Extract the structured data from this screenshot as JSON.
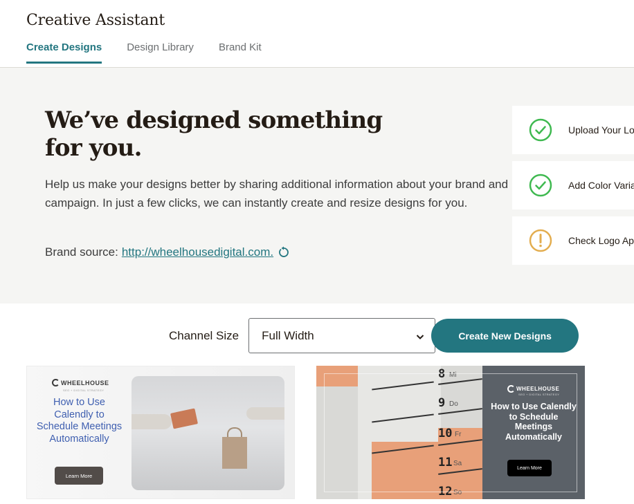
{
  "app": {
    "title": "Creative Assistant"
  },
  "tabs": [
    {
      "label": "Create Designs",
      "active": true
    },
    {
      "label": "Design Library",
      "active": false
    },
    {
      "label": "Brand Kit",
      "active": false
    }
  ],
  "hero": {
    "title": "We’ve designed something for you.",
    "description": "Help us make your designs better by sharing additional information about your brand and campaign. In just a few clicks, we can instantly create and resize designs for you.",
    "brand_source_label": "Brand source:",
    "brand_source_url": "http://wheelhousedigital.com.",
    "refresh_icon": "refresh-icon"
  },
  "checklist": [
    {
      "label": "Upload Your Logo",
      "status": "complete",
      "icon": "check-circle-icon",
      "color": "#3fb950"
    },
    {
      "label": "Add Color Variations",
      "status": "complete",
      "icon": "check-circle-icon",
      "color": "#3fb950"
    },
    {
      "label": "Check Logo Appearance",
      "status": "warning",
      "icon": "exclamation-circle-icon",
      "color": "#e3ad4f"
    }
  ],
  "controls": {
    "channel_size_label": "Channel Size",
    "channel_size_value": "Full Width",
    "create_button_label": "Create New Designs"
  },
  "designs": [
    {
      "brand": "WHEELHOUSE",
      "brand_tagline": "SEO + DIGITAL STRATEGY",
      "headline": "How to Use Calendly to Schedule Meetings Automatically",
      "cta": "Learn More"
    },
    {
      "brand": "WHEELHOUSE",
      "brand_tagline": "SEO + DIGITAL STRATEGY",
      "headline": "How to Use Calendly to Schedule Meetings Automatically",
      "cta": "Learn More",
      "calendar_days": [
        {
          "num": "8",
          "day": "Mi"
        },
        {
          "num": "9",
          "day": "Do"
        },
        {
          "num": "10",
          "day": "Fr"
        },
        {
          "num": "11",
          "day": "Sa"
        },
        {
          "num": "12",
          "day": "So"
        }
      ]
    }
  ],
  "colors": {
    "accent": "#237680",
    "hero_bg": "#f5f5f3",
    "text": "#241c15",
    "success": "#3fb950",
    "warning": "#e3ad4f"
  }
}
